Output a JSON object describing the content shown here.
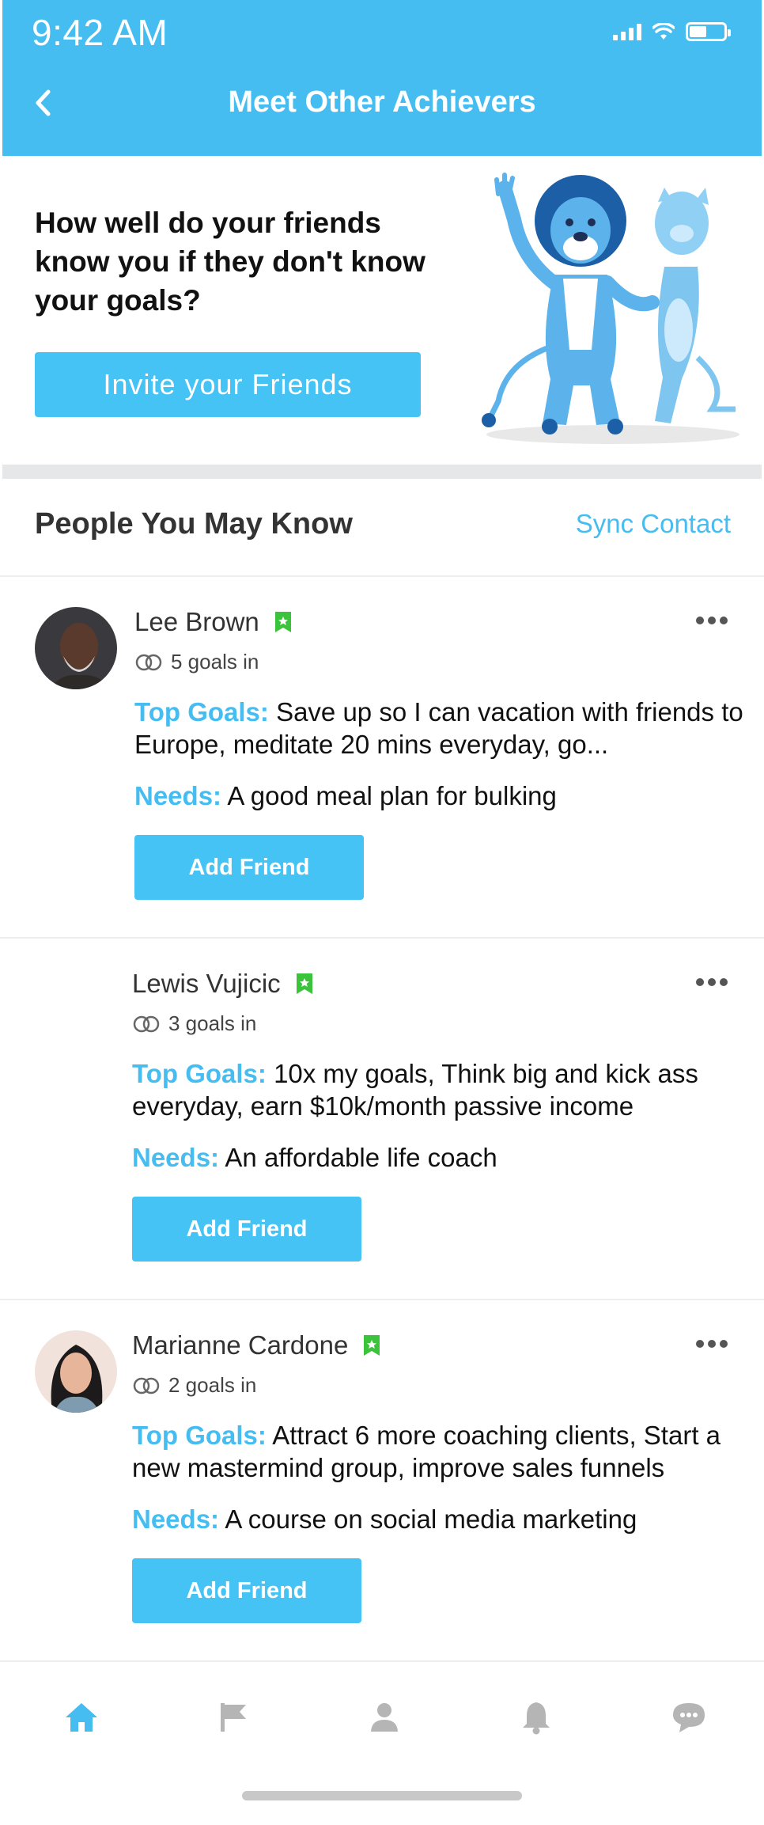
{
  "status_bar": {
    "time": "9:42 AM"
  },
  "header": {
    "title": "Meet Other Achievers"
  },
  "hero": {
    "headline": "How well do your friends know you if they don't know your goals?",
    "invite_label": "Invite your Friends"
  },
  "section": {
    "title": "People You May Know",
    "sync_label": "Sync Contact"
  },
  "labels": {
    "top_goals": "Top Goals:",
    "needs": "Needs:",
    "add_friend": "Add Friend"
  },
  "people": [
    {
      "name": "Lee Brown",
      "goals_count": "5 goals in",
      "top_goals": "Save up so I can vacation with friends to Europe, meditate 20 mins everyday, go...",
      "needs": "A good meal plan for bulking"
    },
    {
      "name": "Lewis Vujicic",
      "goals_count": "3 goals in",
      "top_goals": "10x my goals, Think big and kick ass everyday, earn $10k/month passive income",
      "needs": "An affordable life coach"
    },
    {
      "name": "Marianne Cardone",
      "goals_count": "2 goals in",
      "top_goals": "Attract 6 more coaching clients, Start a new mastermind group, improve sales funnels",
      "needs": "A course on social media marketing"
    }
  ],
  "nav": [
    "home-icon",
    "flag-icon",
    "profile-icon",
    "bell-icon",
    "chat-icon"
  ],
  "colors": {
    "brand": "#45bdf1",
    "button": "#45c3f4",
    "badge": "#3cc33c",
    "nav_inactive": "#b5b5b5"
  }
}
